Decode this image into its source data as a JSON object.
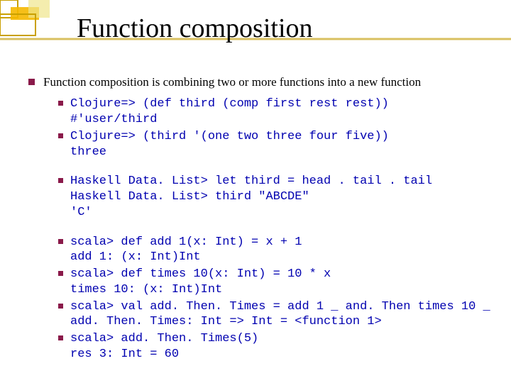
{
  "title": "Function composition",
  "intro": "Function composition is combining two or more functions into a new function",
  "examples": {
    "clojure1": "Clojure=> (def third (comp first rest rest))\n#'user/third",
    "clojure2": "Clojure=> (third '(one two three four five))\nthree",
    "haskell": "Haskell Data. List> let third = head . tail . tail\nHaskell Data. List> third \"ABCDE\"\n'C'",
    "scala1": "scala> def add 1(x: Int) = x + 1\nadd 1: (x: Int)Int",
    "scala2": "scala> def times 10(x: Int) = 10 * x\ntimes 10: (x: Int)Int",
    "scala3": "scala> val add. Then. Times = add 1 _ and. Then times 10 _\nadd. Then. Times: Int => Int = <function 1>",
    "scala4": "scala> add. Then. Times(5)\nres 3: Int = 60"
  }
}
